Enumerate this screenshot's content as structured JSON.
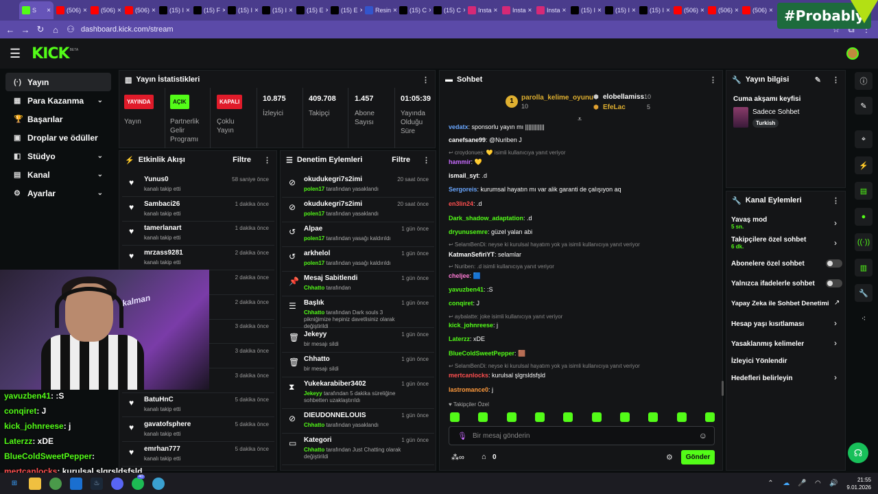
{
  "browser": {
    "tabs": [
      {
        "label": "S",
        "icon": "kick-icon",
        "color": "#53fc18",
        "active": true
      },
      {
        "label": "(506)",
        "icon": "youtube-icon",
        "color": "#ff0000"
      },
      {
        "label": "(506)",
        "icon": "youtube-icon",
        "color": "#ff0000"
      },
      {
        "label": "(506)",
        "icon": "youtube-icon",
        "color": "#ff0000"
      },
      {
        "label": "(15) I",
        "icon": "x-icon",
        "color": "#000000"
      },
      {
        "label": "(15) F",
        "icon": "x-icon",
        "color": "#000000"
      },
      {
        "label": "(15) I",
        "icon": "x-icon",
        "color": "#000000"
      },
      {
        "label": "(15) I",
        "icon": "x-icon",
        "color": "#000000"
      },
      {
        "label": "(15) E",
        "icon": "x-icon",
        "color": "#000000"
      },
      {
        "label": "(15) E",
        "icon": "x-icon",
        "color": "#000000"
      },
      {
        "label": "Resin",
        "icon": "page-icon",
        "color": "#3355cc"
      },
      {
        "label": "(15) C",
        "icon": "x-icon",
        "color": "#000000"
      },
      {
        "label": "(15) C",
        "icon": "x-icon",
        "color": "#000000"
      },
      {
        "label": "Insta",
        "icon": "instagram-icon",
        "color": "#d62976"
      },
      {
        "label": "Insta",
        "icon": "instagram-icon",
        "color": "#d62976"
      },
      {
        "label": "Insta",
        "icon": "instagram-icon",
        "color": "#d62976"
      },
      {
        "label": "(15) I",
        "icon": "x-icon",
        "color": "#000000"
      },
      {
        "label": "(15) I",
        "icon": "x-icon",
        "color": "#000000"
      },
      {
        "label": "(15) I",
        "icon": "x-icon",
        "color": "#000000"
      },
      {
        "label": "(506)",
        "icon": "youtube-icon",
        "color": "#ff0000"
      },
      {
        "label": "(506)",
        "icon": "youtube-icon",
        "color": "#ff0000"
      },
      {
        "label": "(506)",
        "icon": "youtube-icon",
        "color": "#ff0000"
      }
    ],
    "url": "dashboard.kick.com/stream",
    "overlay_tag": "#Probably"
  },
  "kick": {
    "logo": "KICK",
    "beta": "BETA"
  },
  "sidebar": {
    "items": [
      {
        "label": "Yayın",
        "icon": "(·)",
        "active": true,
        "chevron": ""
      },
      {
        "label": "Para Kazanma",
        "icon": "▦",
        "chevron": "⌄"
      },
      {
        "label": "Başarılar",
        "icon": "🏆",
        "chevron": ""
      },
      {
        "label": "Droplar ve ödüller",
        "icon": "▣",
        "chevron": ""
      },
      {
        "label": "Stüdyo",
        "icon": "◧",
        "chevron": "⌄"
      },
      {
        "label": "Kanal",
        "icon": "▤",
        "chevron": "⌄"
      },
      {
        "label": "Ayarlar",
        "icon": "⚙",
        "chevron": "⌄"
      }
    ]
  },
  "stats": {
    "title": "Yayın İstatistikleri",
    "live_badge": "YAYINDA",
    "live_label": "Yayın",
    "partner_badge": "AÇIK",
    "partner_label": "Partnerlik Gelir Programı",
    "multi_badge": "KAPALI",
    "multi_label": "Çoklu Yayın",
    "viewers": "10.875",
    "viewers_label": "İzleyici",
    "followers": "409.708",
    "followers_label": "Takipçi",
    "subs": "1.457",
    "subs_label": "Abone Sayısı",
    "uptime": "01:05:39",
    "uptime_label": "Yayında Olduğu Süre"
  },
  "activity": {
    "title": "Etkinlik Akışı",
    "filter": "Filtre",
    "rows": [
      {
        "name": "Yunus0",
        "sub": "kanalı takip etti",
        "time": "58 saniye önce"
      },
      {
        "name": "Sambaci26",
        "sub": "kanalı takip etti",
        "time": "1 dakika önce"
      },
      {
        "name": "tamerlanart",
        "sub": "kanalı takip etti",
        "time": "1 dakika önce"
      },
      {
        "name": "mrzass9281",
        "sub": "kanalı takip etti",
        "time": "2 dakika önce"
      },
      {
        "name": "",
        "sub": "",
        "time": "2 dakika önce"
      },
      {
        "name": "",
        "sub": "",
        "time": "2 dakika önce"
      },
      {
        "name": "",
        "sub": "",
        "time": "3 dakika önce"
      },
      {
        "name": "",
        "sub": "",
        "time": "3 dakika önce"
      },
      {
        "name": "",
        "sub": "",
        "time": "3 dakika önce"
      },
      {
        "name": "BatuHnC",
        "sub": "kanalı takip etti",
        "time": "5 dakika önce"
      },
      {
        "name": "gavatofsphere",
        "sub": "kanalı takip etti",
        "time": "5 dakika önce"
      },
      {
        "name": "emrhan777",
        "sub": "kanalı takip etti",
        "time": "5 dakika önce"
      }
    ]
  },
  "moderation": {
    "title": "Denetim Eylemleri",
    "filter": "Filtre",
    "rows": [
      {
        "name": "okudukegri7s2imi",
        "by": "polen17",
        "sub": "tarafından yasaklandı",
        "time": "20 saat önce",
        "icon": "⊘"
      },
      {
        "name": "okudukegri7s2imi",
        "by": "polen17",
        "sub": "tarafından yasaklandı",
        "time": "20 saat önce",
        "icon": "⊘"
      },
      {
        "name": "Alpae",
        "by": "polen17",
        "sub": "tarafından yasağı kaldırıldı",
        "time": "1 gün önce",
        "icon": "↺"
      },
      {
        "name": "arkhelol",
        "by": "polen17",
        "sub": "tarafından yasağı kaldırıldı",
        "time": "1 gün önce",
        "icon": "↺"
      },
      {
        "name": "Mesaj Sabitlendi",
        "by": "Chhatto",
        "sub": "tarafından",
        "time": "1 gün önce",
        "icon": "📌"
      },
      {
        "name": "Başlık",
        "by": "Chhatto",
        "sub": "tarafından Dark souls 3 pikniğimize hepiniz davetlisiniz olarak değiştirildi",
        "time": "1 gün önce",
        "icon": "☰"
      },
      {
        "name": "Jekeyy",
        "by": "",
        "sub": "bir mesajı sildi",
        "time": "1 gün önce",
        "icon": "🗑"
      },
      {
        "name": "Chhatto",
        "by": "",
        "sub": "bir mesajı sildi",
        "time": "1 gün önce",
        "icon": "🗑"
      },
      {
        "name": "Yukekarabiber3402",
        "by": "Jekeyy",
        "sub": "tarafından 5 dakika süreliğine sohbetten uzaklaştırıldı",
        "time": "1 gün önce",
        "icon": "⧗"
      },
      {
        "name": "DIEUDONNELOUIS",
        "by": "Chhatto",
        "sub": "tarafından yasaklandı",
        "time": "1 gün önce",
        "icon": "⊘"
      },
      {
        "name": "Kategori",
        "by": "Chhatto",
        "sub": "tarafından Just Chatting olarak değiştirildi",
        "time": "1 gün önce",
        "icon": "▭"
      }
    ]
  },
  "chat": {
    "title": "Sohbet",
    "top1_rank": "1",
    "top1_name": "parolla_kelime_oyunu",
    "top1_val": "10",
    "top2_name": "elobellamiss",
    "top2_val": "10",
    "top3_name": "EfeLac",
    "top3_val": "5",
    "messages": [
      {
        "user": "vedatx",
        "color": "#6aa7ff",
        "text": ": sponsorlu yayın mı ||||||||||||"
      },
      {
        "user": "canefsane99",
        "color": "#ffffff",
        "text": ": @Nuriben J"
      },
      {
        "reply": "↩ croydonues: 💛 isimli kullanıcıya yanıt veriyor"
      },
      {
        "user": "hammir",
        "color": "#c86bff",
        "text": ": 💛"
      },
      {
        "user": "ismail_syt",
        "color": "#ffffff",
        "text": ": .d"
      },
      {
        "user": "Sergoreis",
        "color": "#6aa7ff",
        "text": ": kurumsal hayatın mı var alik garanti de çalışıyon aq"
      },
      {
        "user": "en3lin24",
        "color": "#ff4f4f",
        "text": ": .d"
      },
      {
        "user": "Dark_shadow_adaptation",
        "color": "#53fc18",
        "text": ": .d"
      },
      {
        "user": "dryunusemre",
        "color": "#53fc18",
        "text": ": güzel yalan abi"
      },
      {
        "reply": "↩ SelamBenDi: neyse ki kurulsal hayatım yok ya isimli kullanıcıya yanıt veriyor"
      },
      {
        "user": "KatmanSefiriYT",
        "color": "#ffffff",
        "text": ": selamlar"
      },
      {
        "reply": "↩ Nuriben: .d isimli kullanıcıya yanıt veriyor"
      },
      {
        "user": "cheljee",
        "color": "#ff7bd5",
        "text": ": 🟦"
      },
      {
        "user": "yavuzben41",
        "color": "#53fc18",
        "text": ": :S"
      },
      {
        "user": "conqiret",
        "color": "#53fc18",
        "text": ": J"
      },
      {
        "reply": "↩ aybalatte: joke isimli kullanıcıya yanıt veriyor"
      },
      {
        "user": "kick_johnreese",
        "color": "#53fc18",
        "text": ": j"
      },
      {
        "user": "Laterzz",
        "color": "#53fc18",
        "text": ": xDE"
      },
      {
        "user": "BlueColdSweetPepper",
        "color": "#53fc18",
        "text": ": 🟫"
      },
      {
        "reply": "↩ SelamBenDi: neyse ki kurulsal hayatım yok ya isimli kullanıcıya yanıt veriyor"
      },
      {
        "user": "mertcanlocks",
        "color": "#ff4f4f",
        "text": ": kurulsal şlgrsldsfşld"
      },
      {
        "user": "lastromance0",
        "color": "#ff9a3c",
        "text": ": j"
      }
    ],
    "followers_only": "Takipçiler Özel",
    "placeholder": "Bir mesaj gönderin",
    "points": "0",
    "send": "Gönder"
  },
  "stream_info": {
    "title": "Yayın bilgisi",
    "stream_title": "Cuma akşamı keyfisi",
    "category": "Sadece Sohbet",
    "tag": "Turkish"
  },
  "channel_actions": {
    "title": "Kanal Eylemleri",
    "slow_mode": "Yavaş mod",
    "slow_val": "5 sn.",
    "followers_chat": "Takipçilere özel sohbet",
    "followers_val": "6 dk.",
    "subs_chat": "Abonelere özel sohbet",
    "emote_chat": "Yalnızca ifadelerle sohbet",
    "ai_mod": "Yapay Zeka ile Sohbet Denetimi",
    "age": "Hesap yaşı kısıtlaması",
    "banned_words": "Yasaklanmış kelimeler",
    "redirect": "İzleyici Yönlendir",
    "goals": "Hedefleri belirleyin"
  },
  "overlay_chat": [
    {
      "user": "yavuzben41",
      "text": " : :S",
      "color": "#53fc18"
    },
    {
      "user": "conqiret",
      "text": " : J",
      "color": "#53fc18"
    },
    {
      "user": "kick_johnreese",
      "text": " : j",
      "color": "#53fc18"
    },
    {
      "user": "Laterzz",
      "text": " : xDE",
      "color": "#53fc18"
    },
    {
      "user": "BlueColdSweetPepper",
      "text": " :",
      "color": "#53fc18"
    },
    {
      "user": "mertcanlocks",
      "text": " : kurulsal şlgrsldsfşld",
      "color": "#ff4f4f"
    }
  ],
  "cam_text": "kalman",
  "taskbar": {
    "time": "21:55",
    "date": "9.01.2026",
    "notif": "40"
  }
}
